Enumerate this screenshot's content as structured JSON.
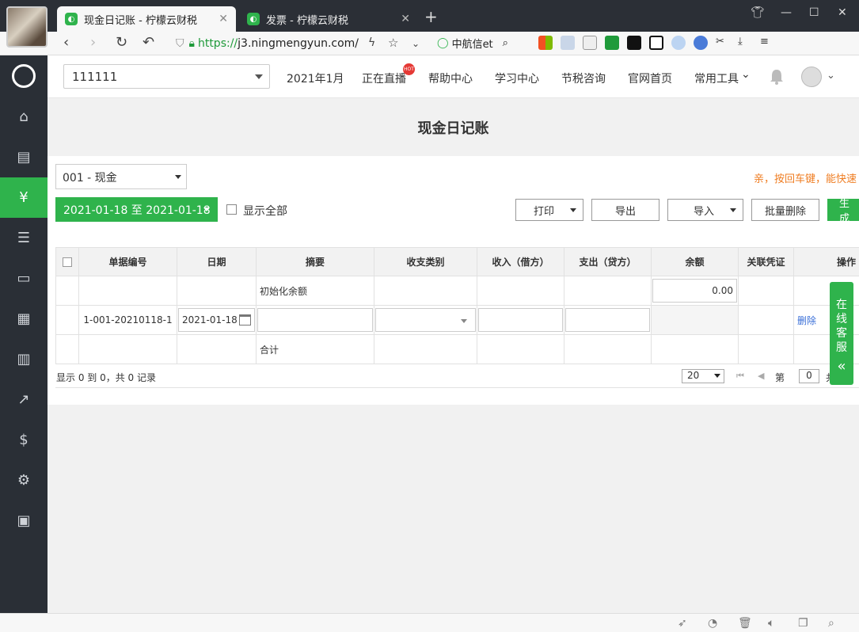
{
  "browser": {
    "tabs": [
      {
        "title": "现金日记账 - 柠檬云财税",
        "active": true
      },
      {
        "title": "发票 - 柠檬云财税",
        "active": false
      }
    ],
    "url_scheme": "https://",
    "url_host": "j3.ningmengyun.com/",
    "search_engine_label": "中航信et"
  },
  "header": {
    "account_select": "111111",
    "period": "2021年1月",
    "nav": [
      "正在直播",
      "帮助中心",
      "学习中心",
      "节税咨询",
      "官网首页",
      "常用工具"
    ],
    "hot_badge": "HOT"
  },
  "page": {
    "title": "现金日记账",
    "account_dropdown": "001 - 现金",
    "hint": "亲，按回车键，能快速",
    "date_range": "2021-01-18 至 2021-01-18",
    "show_all_label": "显示全部",
    "buttons": {
      "print": "打印",
      "export": "导出",
      "import": "导入",
      "batch_delete": "批量删除",
      "generate": "生成"
    }
  },
  "table": {
    "columns": [
      "单据编号",
      "日期",
      "摘要",
      "收支类别",
      "收入（借方）",
      "支出（贷方）",
      "余额",
      "关联凭证",
      "操作"
    ],
    "init_row": {
      "summary": "初始化余额",
      "balance": "0.00"
    },
    "entry_row": {
      "doc_no": "1-001-20210118-1",
      "date": "2021-01-18",
      "action": "删除"
    },
    "total_row": {
      "summary": "合计"
    }
  },
  "pager": {
    "summary": "显示 0 到 0，共 0 记录",
    "page_size": "20",
    "page_label": "第",
    "page_value": "0",
    "total_label": "共"
  },
  "service": {
    "label_chars": [
      "在",
      "线",
      "客",
      "服"
    ],
    "arrow": "«"
  },
  "colors": {
    "brand_green": "#2fb34c",
    "sidebar_bg": "#2a2f36",
    "hint_orange": "#ef7d22",
    "link_blue": "#3a6fd8"
  }
}
